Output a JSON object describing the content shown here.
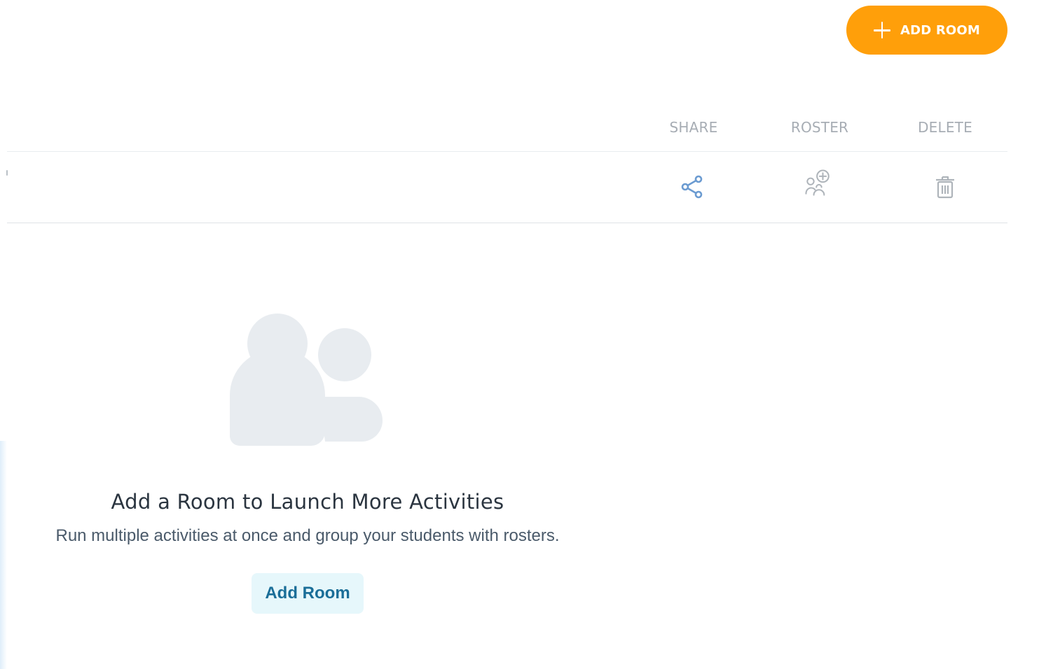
{
  "header": {
    "add_room_label": "ADD ROOM"
  },
  "table": {
    "columns": {
      "share": "SHARE",
      "roster": "ROSTER",
      "delete": "DELETE"
    }
  },
  "empty_state": {
    "title": "Add a Room to Launch More Activities",
    "subtitle": "Run multiple activities at once and group your students with rosters.",
    "button_label": "Add Room"
  },
  "icons": {
    "add": "plus-icon",
    "share": "share-icon",
    "roster": "add-group-icon",
    "delete": "trash-icon",
    "illustration": "people-icon"
  },
  "colors": {
    "primary_button": "#ff9f0a",
    "secondary_button_bg": "#e6f7fb",
    "secondary_button_text": "#1a6e98",
    "share_icon": "#6b9bd1",
    "muted_icon": "#aeb4ba",
    "illustration": "#e8ecf0"
  }
}
